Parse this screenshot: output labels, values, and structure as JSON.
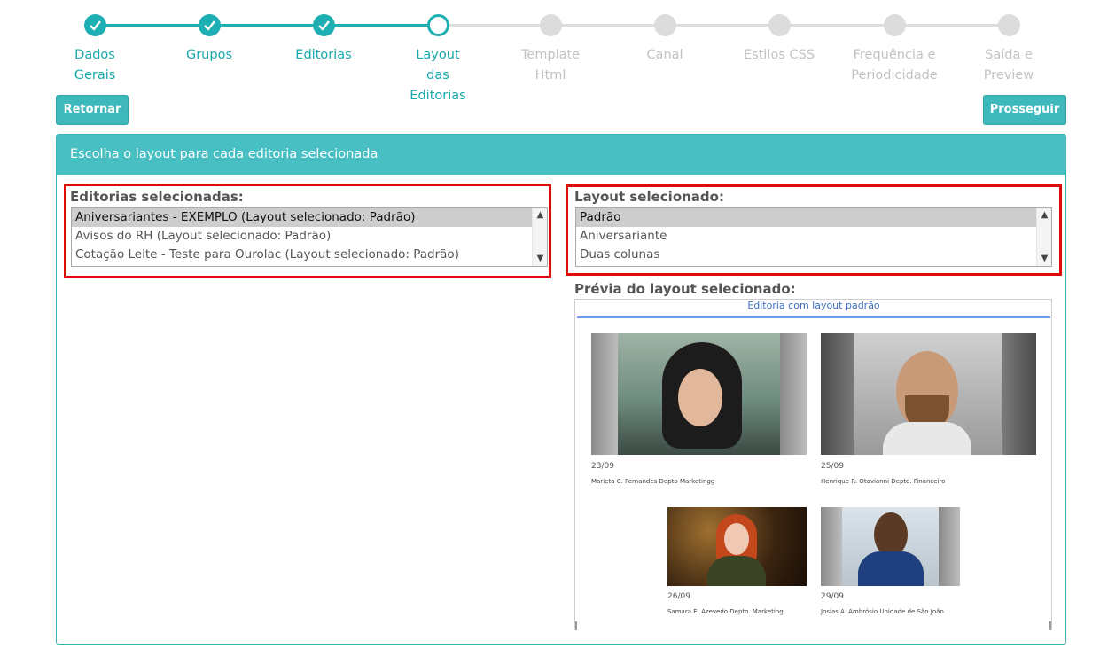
{
  "wizard": {
    "steps": [
      {
        "label": "Dados Gerais",
        "state": "done"
      },
      {
        "label": "Grupos",
        "state": "done"
      },
      {
        "label": "Editorias",
        "state": "done"
      },
      {
        "label": "Layout das Editorias",
        "state": "current"
      },
      {
        "label": "Template Html",
        "state": "todo"
      },
      {
        "label": "Canal",
        "state": "todo"
      },
      {
        "label": "Estilos CSS",
        "state": "todo"
      },
      {
        "label": "Frequência e Periodicidade",
        "state": "todo"
      },
      {
        "label": "Saída e Preview",
        "state": "todo"
      }
    ]
  },
  "actions": {
    "back_label": "Retornar",
    "next_label": "Prosseguir"
  },
  "panel": {
    "title": "Escolha o layout para cada editoria selecionada"
  },
  "editorias": {
    "label": "Editorias selecionadas:",
    "options": [
      "Aniversariantes - EXEMPLO (Layout selecionado: Padrão)",
      "Avisos do RH (Layout selecionado: Padrão)",
      "Cotação Leite - Teste para Ourolac (Layout selecionado: Padrão)"
    ],
    "selected_index": 0
  },
  "layout": {
    "label": "Layout selecionado:",
    "options": [
      "Padrão",
      "Aniversariante",
      "Duas colunas"
    ],
    "selected_index": 0
  },
  "preview": {
    "label": "Prévia do layout selecionado:",
    "title": "Editoria com layout padrão",
    "cards": [
      {
        "date": "23/09",
        "name": "Marieta C. Fernandes Depto Marketingg"
      },
      {
        "date": "25/09",
        "name": "Henrique R. Otavianni Depto. Financeiro"
      },
      {
        "date": "26/09",
        "name": "Samara E. Azevedo Depto. Marketing"
      },
      {
        "date": "29/09",
        "name": "Josias A. Ambrósio Unidade de São João"
      }
    ]
  },
  "colors": {
    "accent": "#1eafb3",
    "panel_header": "#47bfc3",
    "highlight": "#e00a0a"
  }
}
